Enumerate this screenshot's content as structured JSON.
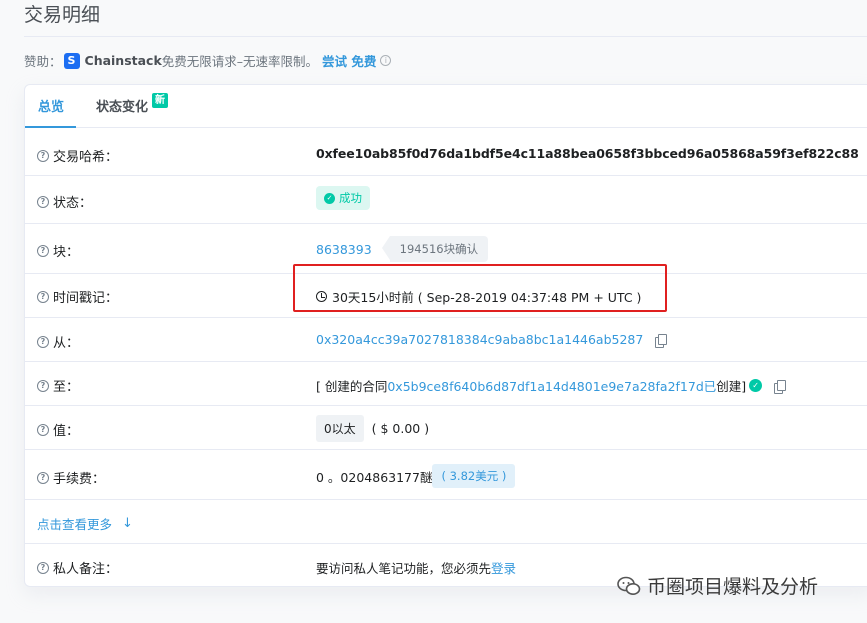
{
  "page": {
    "title": "交易明细"
  },
  "sponsor": {
    "prefix": "赞助：",
    "logo_letter": "S",
    "brand": "Chainstack",
    "text": "免费无限请求–无速率限制。",
    "link": "尝试 免费",
    "info": "i"
  },
  "tabs": [
    {
      "label": "总览",
      "active": true
    },
    {
      "label": "状态变化",
      "badge": "新"
    }
  ],
  "rows": {
    "hash": {
      "label": "交易哈希：",
      "value": "0xfee10ab85f0d76da1bdf5e4c11a88bea0658f3bbced96a05868a59f3ef822c88"
    },
    "status": {
      "label": "状态：",
      "value": "成功"
    },
    "block": {
      "label": "块：",
      "value": "8638393",
      "confirmations": "194516块确认"
    },
    "timestamp": {
      "label": "时间戳记：",
      "value": "30天15小时前 ( Sep-28-2019 04:37:48 PM + UTC )"
    },
    "from": {
      "label": "从：",
      "value": "0x320a4cc39a7027818384c9aba8bc1a1446ab5287"
    },
    "to": {
      "label": "至：",
      "prefix": "[ 创建的合同",
      "address": "0x5b9ce8f640b6d87df1a14d4801e9e7a28fa2f17d已",
      "suffix": " 创建]"
    },
    "value": {
      "label": "值：",
      "amount": "0以太",
      "usd": "( $ 0.00 )"
    },
    "fee": {
      "label": "手续费：",
      "amount": "0 。0204863177醚",
      "usd": "( 3.82美元 )"
    },
    "more": {
      "label": "点击查看更多",
      "arrow": "↓"
    },
    "note": {
      "label": "私人备注：",
      "text": "要访问私人笔记功能，您必须先",
      "link": "登录"
    }
  },
  "watermark": {
    "text": "币圈项目爆料及分析"
  },
  "colors": {
    "accent": "#3498db",
    "success": "#00c9a7",
    "highlight_box": "#e02020"
  },
  "icons": {
    "question": "?",
    "check": "✓"
  }
}
